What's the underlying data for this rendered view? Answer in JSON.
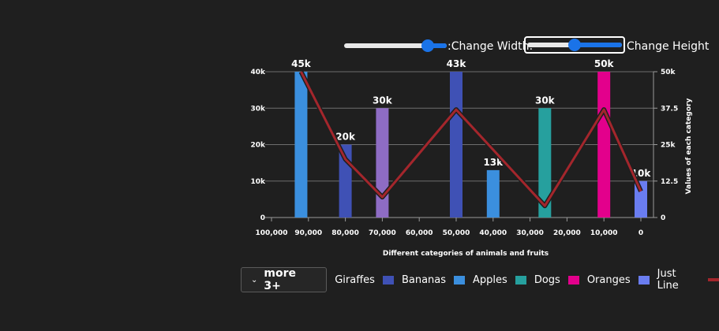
{
  "controls": {
    "width_label": ":Change Width:",
    "height_label": "Change Height"
  },
  "legend": {
    "more_label": "more 3+",
    "items": [
      {
        "label": "Giraffes",
        "color": "#3f51b5"
      },
      {
        "label": "Bananas",
        "color": "#3b8fde"
      },
      {
        "label": "Apples",
        "color": "#26a09e"
      },
      {
        "label": "Dogs",
        "color": "#e3008c"
      },
      {
        "label": "Oranges",
        "color": "#6a7df0"
      },
      {
        "label": "Just Line",
        "color": "#a4262c",
        "line": true
      }
    ]
  },
  "chart_data": {
    "type": "bar",
    "xlabel": "Different categories of animals and fruits",
    "ylabel_secondary": "Values of each category",
    "x_ticks": [
      "100,000",
      "90,000",
      "80,000",
      "70,000",
      "60,000",
      "50,000",
      "40,000",
      "30,000",
      "20,000",
      "10,000",
      "0"
    ],
    "x_range": [
      100000,
      0
    ],
    "y_ticks": [
      "0",
      "10k",
      "20k",
      "30k",
      "40k"
    ],
    "ylim": [
      0,
      40000
    ],
    "y2_ticks": [
      "0",
      "12.5",
      "25k",
      "37.5",
      "50k"
    ],
    "y2lim": [
      0,
      50000
    ],
    "grid": true,
    "bars": [
      {
        "x": 92000,
        "value": 45000,
        "label": "45k",
        "color": "#3b8fde"
      },
      {
        "x": 80000,
        "value": 20000,
        "label": "20k",
        "color": "#3f51b5"
      },
      {
        "x": 70000,
        "value": 30000,
        "label": "30k",
        "color": "#8e6cc4"
      },
      {
        "x": 50000,
        "value": 43000,
        "label": "43k",
        "color": "#3f51b5"
      },
      {
        "x": 40000,
        "value": 13000,
        "label": "13k",
        "color": "#3b8fde"
      },
      {
        "x": 26000,
        "value": 30000,
        "label": "30k",
        "color": "#26a09e"
      },
      {
        "x": 10000,
        "value": 50000,
        "label": "50k",
        "color": "#e3008c"
      },
      {
        "x": 0,
        "value": 10000,
        "label": "10k",
        "color": "#6a7df0"
      }
    ],
    "line": {
      "name": "Just Line",
      "color": "#a4262c",
      "points": [
        {
          "x": 92000,
          "y": 50000
        },
        {
          "x": 80000,
          "y": 20000
        },
        {
          "x": 70000,
          "y": 7000
        },
        {
          "x": 50000,
          "y": 37000
        },
        {
          "x": 26000,
          "y": 4000
        },
        {
          "x": 10000,
          "y": 37000
        },
        {
          "x": 0,
          "y": 9000
        }
      ]
    }
  }
}
